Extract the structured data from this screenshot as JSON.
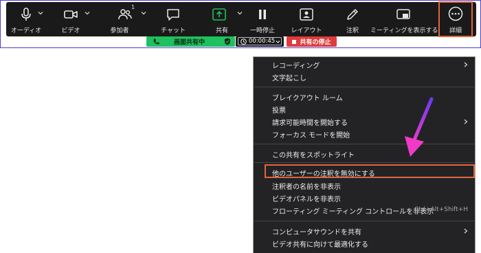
{
  "toolbar": {
    "audio": "オーディオ",
    "video": "ビデオ",
    "participants": "参加者",
    "participants_count": "1",
    "chat": "チャット",
    "share": "共有",
    "pause": "一時停止",
    "layout": "レイアウト",
    "annotate": "注釈",
    "show_meeting": "ミーティングを表示する",
    "more": "詳細"
  },
  "share_bar": {
    "sharing_status": "画面共有中",
    "timer": "00:00:45",
    "stop_label": "共有の停止"
  },
  "menu": {
    "recording": "レコーディング",
    "transcript": "文字起こし",
    "breakout": "ブレイクアウト ルーム",
    "poll": "投票",
    "request_time": "請求可能時間を開始する",
    "focus_mode": "フォーカス モードを開始",
    "spotlight": "この共有をスポットライト",
    "disable_annotation": "他のユーザーの注釈を無効にする",
    "hide_annotator": "注釈者の名前を非表示",
    "hide_video_panel": "ビデオパネルを非表示",
    "hide_floating": "フローティング ミーティング コントロールを非表示",
    "hide_floating_shortcut": "Ctrl+Alt+Shift+H",
    "share_sound": "コンピュータサウンドを共有",
    "optimize": "ビデオ共有に向けて最適化する"
  },
  "colors": {
    "toolbar_bg": "#1a1a1a",
    "share_green": "#1fc05e",
    "stop_red": "#e03a3a",
    "highlight": "#e8643a",
    "arrow": "#e83ad0",
    "menu_bg": "#232325"
  }
}
